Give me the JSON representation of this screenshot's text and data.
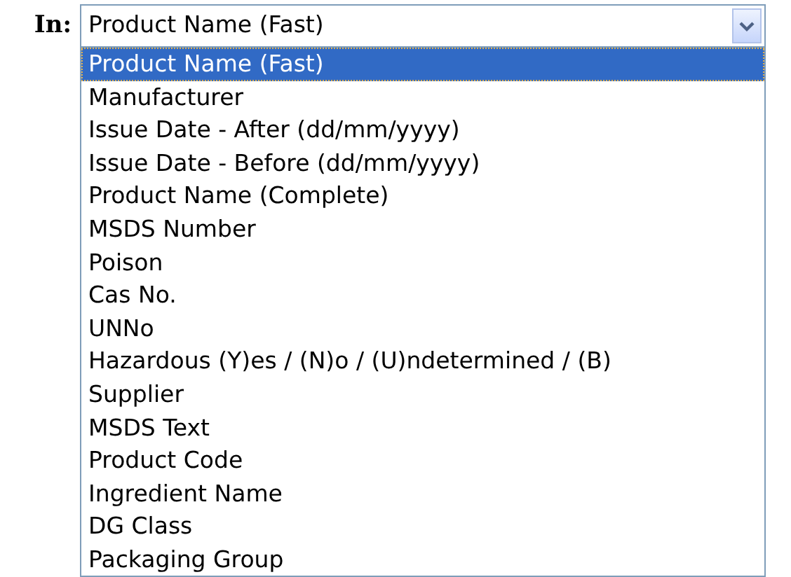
{
  "search_in": {
    "label": "In:",
    "value": "Product Name (Fast)",
    "options": [
      {
        "label": "Product Name (Fast)",
        "selected": true
      },
      {
        "label": "Manufacturer",
        "selected": false
      },
      {
        "label": "Issue Date - After (dd/mm/yyyy)",
        "selected": false
      },
      {
        "label": "Issue Date - Before (dd/mm/yyyy)",
        "selected": false
      },
      {
        "label": "Product Name (Complete)",
        "selected": false
      },
      {
        "label": "MSDS Number",
        "selected": false
      },
      {
        "label": "Poison",
        "selected": false
      },
      {
        "label": "Cas No.",
        "selected": false
      },
      {
        "label": "UNNo",
        "selected": false
      },
      {
        "label": "Hazardous (Y)es / (N)o / (U)ndetermined / (B)",
        "selected": false
      },
      {
        "label": "Supplier",
        "selected": false
      },
      {
        "label": "MSDS Text",
        "selected": false
      },
      {
        "label": "Product Code",
        "selected": false
      },
      {
        "label": "Ingredient Name",
        "selected": false
      },
      {
        "label": "DG Class",
        "selected": false
      },
      {
        "label": "Packaging Group",
        "selected": false
      }
    ]
  }
}
